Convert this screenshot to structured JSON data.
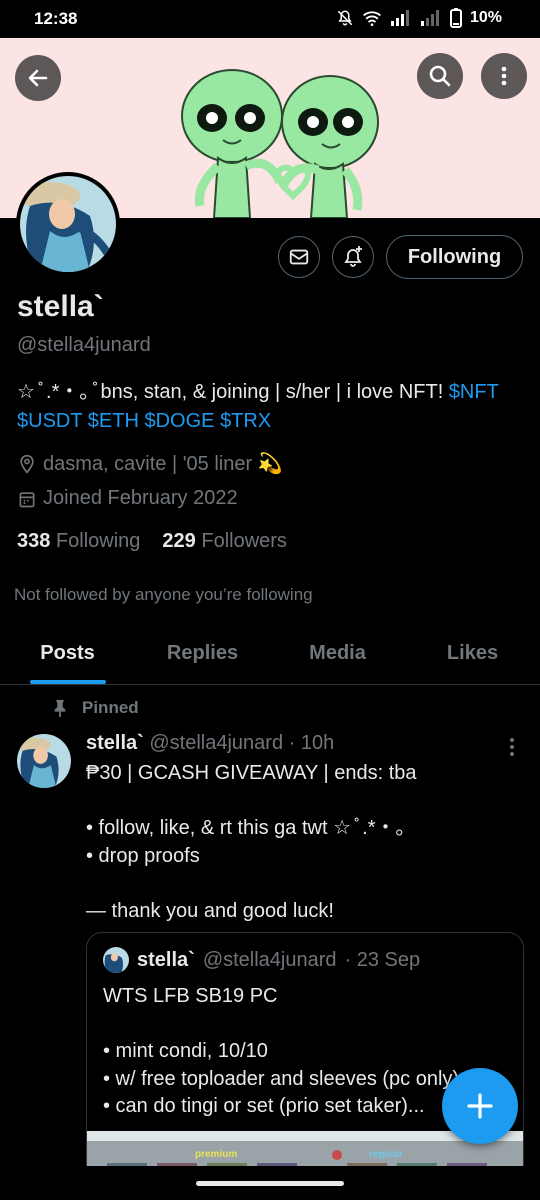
{
  "status_bar": {
    "time": "12:38",
    "battery": "10%"
  },
  "profile": {
    "display_name": "stella`",
    "handle": "@stella4junard",
    "bio_text": "☆ ̊ .*・｡ ̊ bns, stan, & joining | s/her | i love NFT! ",
    "bio_tags": [
      "$NFT",
      "$USDT",
      "$ETH",
      "$DOGE",
      "$TRX"
    ],
    "location": "dasma, cavite | '05 liner 💫",
    "joined": "Joined February 2022",
    "following_count": "338",
    "following_label": "Following",
    "followers_count": "229",
    "followers_label": "Followers",
    "follow_button": "Following",
    "not_followed_text": "Not followed by anyone you’re following"
  },
  "tabs": [
    {
      "label": "Posts",
      "active": true
    },
    {
      "label": "Replies",
      "active": false
    },
    {
      "label": "Media",
      "active": false
    },
    {
      "label": "Likes",
      "active": false
    }
  ],
  "pinned_post": {
    "pinned_label": "Pinned",
    "author_name": "stella`",
    "author_handle": "@stella4junard",
    "time": "· 10h",
    "body": "₱30 | GCASH GIVEAWAY | ends: tba\n\n• follow, like, & rt this ga twt ☆ ̊ .*・｡\n• drop proofs\n\n— thank you and good luck!",
    "quote": {
      "author_name": "stella`",
      "author_handle": "@stella4junard",
      "date": "· 23 Sep",
      "body": "WTS LFB SB19 PC\n\n• mint condi, 10/10\n• w/ free toploader and sleeves (pc only)\n• can do tingi or set (prio set taker)...",
      "image_labels": [
        "premium",
        "regular"
      ]
    }
  },
  "icons": {
    "back": "arrow-left-icon",
    "search": "search-icon",
    "more": "more-vertical-icon",
    "message": "envelope-icon",
    "notify": "bell-plus-icon",
    "pin": "pin-icon",
    "location": "map-pin-icon",
    "calendar": "calendar-icon",
    "compose": "plus-icon"
  },
  "colors": {
    "accent": "#1d9bf0",
    "background": "#000000",
    "text_primary": "#e7e9ea",
    "text_secondary": "#71767b",
    "banner_bg": "#fce3e4",
    "alien_green": "#98e8a2"
  }
}
